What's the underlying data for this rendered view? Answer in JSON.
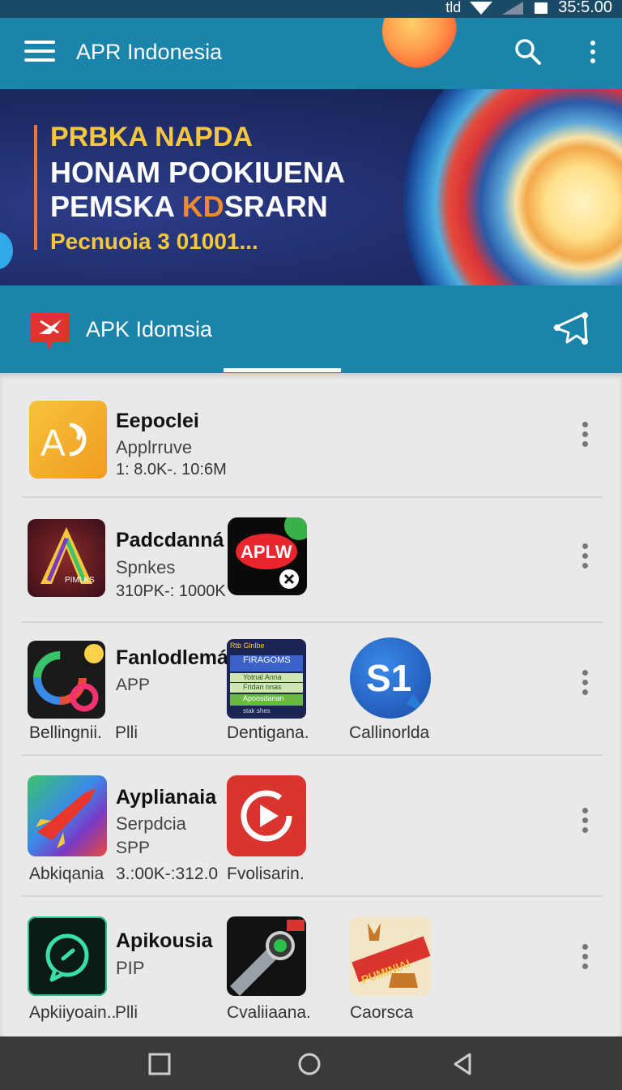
{
  "status_bar": {
    "signal_text": "tld",
    "time": "35:5.00"
  },
  "toolbar": {
    "title": "APR Indonesia",
    "menu_icon": "hamburger-icon",
    "search_icon": "search-icon",
    "more_icon": "more-vert-icon"
  },
  "banner": {
    "line1": "PRBKA NAPDA",
    "line2": "HONAM POOKIUENA",
    "line3_a": "PEMSKA ",
    "line3_highlight": "KD",
    "line3_b": "SRARN",
    "line4": "Pecnuoia 3 01001...",
    "colors": {
      "headline_yellow": "#f5c740",
      "accent_orange": "#f08a2e"
    }
  },
  "section": {
    "title": "APK Idomsia",
    "share_icon": "share-icon",
    "logo_icon": "apk-logo-icon"
  },
  "apps": [
    {
      "name": "Eepoclei",
      "category": "Applrruve",
      "stats": "1: 8.0K-. 10:6M"
    },
    {
      "name": "Padcdanná",
      "category": "Spnkes",
      "stats": "310PK-: 1000K",
      "icon_text": "PIMLKS",
      "extra_icon_text": "APLW"
    },
    {
      "name": "Fanlodlemá",
      "category": "APP",
      "icon_caption": "Bellingnii.",
      "price": "Plli",
      "extra_caption_1": "Dentigana.",
      "extra_caption_2": "Callinorlda",
      "extra_icon_2_text": "S1",
      "mini_list": [
        "Rtb Glnlbe",
        "FIRAGOMS",
        "Yotnal Anna",
        "Fridan nnas",
        "Apoosdanan",
        "stak shes"
      ]
    },
    {
      "name": "Ayplianaia",
      "category": "Serpdcia",
      "extra_line": "SPP",
      "icon_caption": "Abkiqania",
      "stats": "3.:00K-:312.0",
      "extra_caption_1": "Fvolisarin."
    },
    {
      "name": "Apikousia",
      "category": "PIP",
      "icon_caption": "Apkiiyoain..",
      "price": "Plli",
      "extra_caption_1": "Cvaliiaana.",
      "extra_caption_2": "Caorsca",
      "extra_icon_2_text": "PUMINIAI"
    }
  ],
  "nav_bar": {
    "recents_icon": "square-icon",
    "home_icon": "circle-icon",
    "back_icon": "triangle-back-icon"
  }
}
